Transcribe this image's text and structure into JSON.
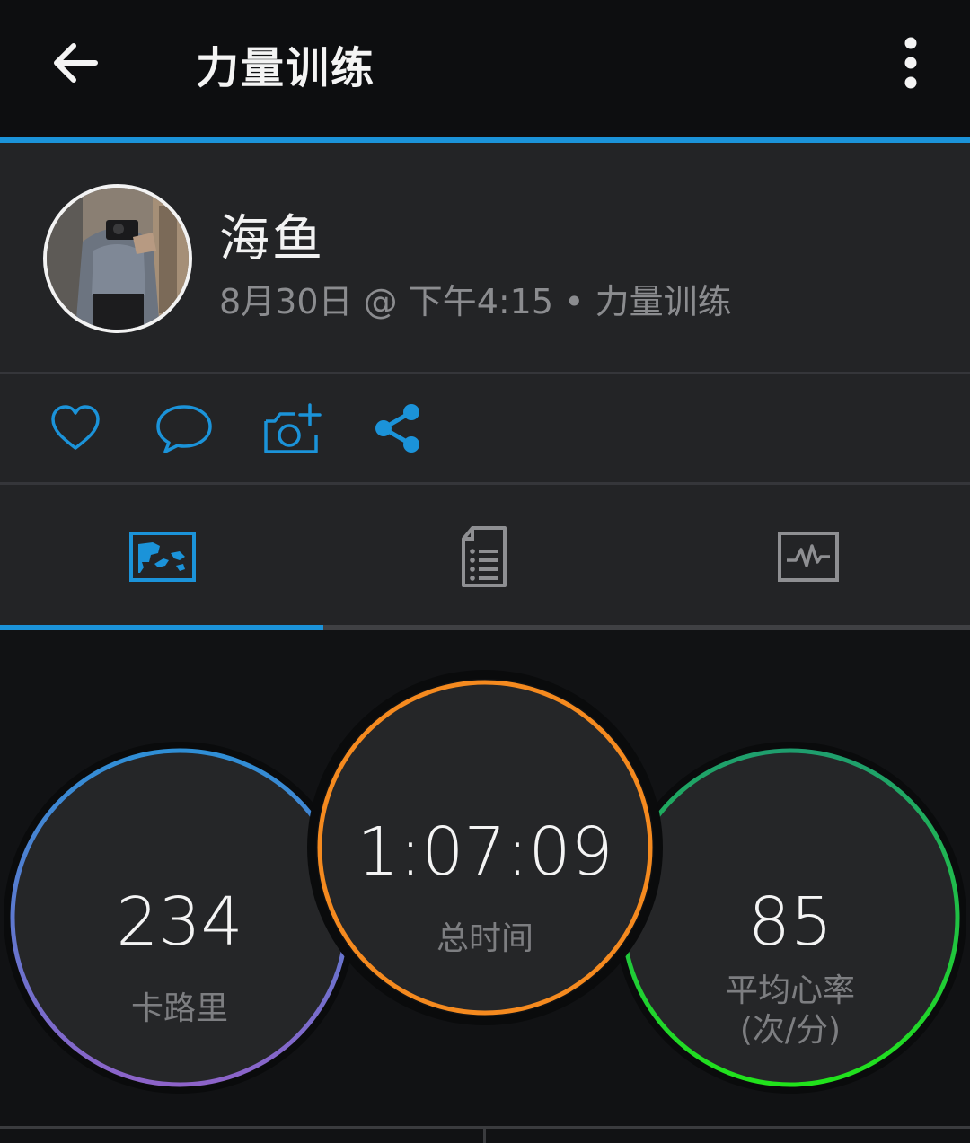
{
  "header": {
    "title": "力量训练",
    "back_icon": "arrow-left-icon",
    "menu_icon": "more-vertical-icon"
  },
  "profile": {
    "name": "海鱼",
    "meta": "8月30日 @ 下午4:15 • 力量训练"
  },
  "actions": [
    {
      "icon": "heart-icon"
    },
    {
      "icon": "comment-icon"
    },
    {
      "icon": "add-photo-icon"
    },
    {
      "icon": "share-icon"
    }
  ],
  "tabs": [
    {
      "icon": "overview-tab-icon",
      "active": true
    },
    {
      "icon": "details-tab-icon",
      "active": false
    },
    {
      "icon": "charts-tab-icon",
      "active": false
    }
  ],
  "stats": {
    "calories": {
      "value": "234",
      "label": "卡路里"
    },
    "total_time": {
      "value": "1:07:09",
      "label": "总时间"
    },
    "avg_hr": {
      "value": "85",
      "label_line1": "平均心率",
      "label_line2": "(次/分)"
    }
  },
  "colors": {
    "accent": "#1b93d9",
    "calories_ring_start": "#2f8fd6",
    "calories_ring_end": "#8d63c9",
    "time_ring": "#f58a1f",
    "hr_ring_start": "#1f9e6e",
    "hr_ring_end": "#21e31b"
  }
}
